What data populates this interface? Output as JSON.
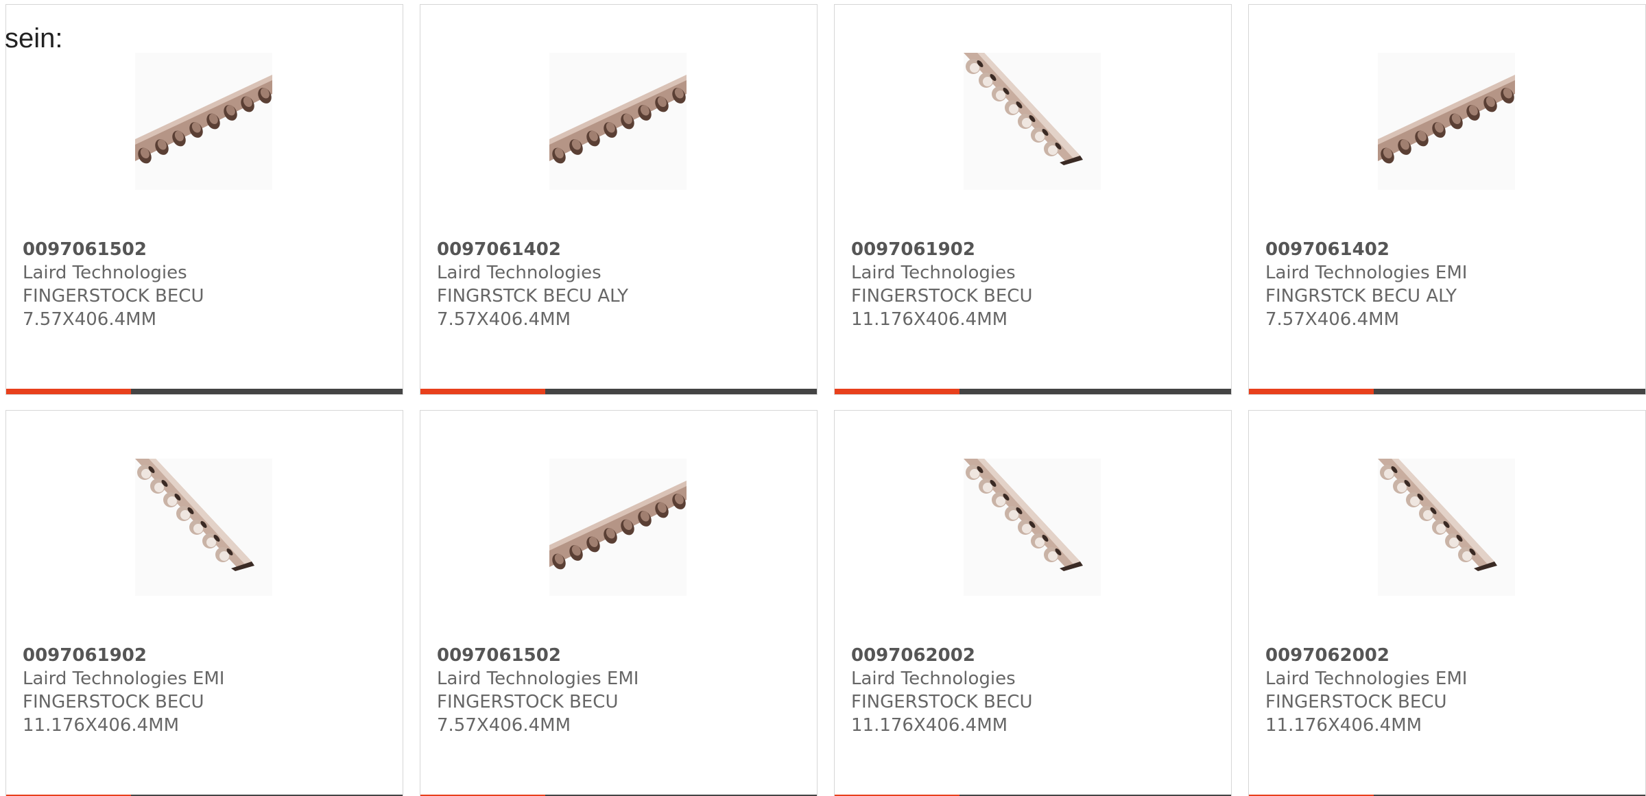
{
  "intro_text": "sein:",
  "colors": {
    "accent": "#e8401c",
    "bar": "#444444",
    "text": "#666666",
    "border": "#d6d6d6"
  },
  "products": [
    {
      "part_number": "0097061502",
      "manufacturer": "Laird Technologies",
      "line1": "FINGERSTOCK BECU",
      "line2": "7.57X406.4MM",
      "image_icon": "fingerstock-horizontal-icon"
    },
    {
      "part_number": "0097061402",
      "manufacturer": "Laird Technologies",
      "line1": "FINGRSTCK BECU ALY",
      "line2": "7.57X406.4MM",
      "image_icon": "fingerstock-horizontal-icon"
    },
    {
      "part_number": "0097061902",
      "manufacturer": "Laird Technologies",
      "line1": "FINGERSTOCK BECU",
      "line2": "11.176X406.4MM",
      "image_icon": "fingerstock-diagonal-icon"
    },
    {
      "part_number": "0097061402",
      "manufacturer": "Laird Technologies EMI",
      "line1": "FINGRSTCK BECU ALY",
      "line2": "7.57X406.4MM",
      "image_icon": "fingerstock-horizontal-icon"
    },
    {
      "part_number": "0097061902",
      "manufacturer": "Laird Technologies EMI",
      "line1": "FINGERSTOCK BECU",
      "line2": "11.176X406.4MM",
      "image_icon": "fingerstock-diagonal-icon"
    },
    {
      "part_number": "0097061502",
      "manufacturer": "Laird Technologies EMI",
      "line1": "FINGERSTOCK BECU",
      "line2": "7.57X406.4MM",
      "image_icon": "fingerstock-horizontal-icon"
    },
    {
      "part_number": "0097062002",
      "manufacturer": "Laird Technologies",
      "line1": "FINGERSTOCK BECU",
      "line2": "11.176X406.4MM",
      "image_icon": "fingerstock-diagonal-icon"
    },
    {
      "part_number": "0097062002",
      "manufacturer": "Laird Technologies EMI",
      "line1": "FINGERSTOCK BECU",
      "line2": "11.176X406.4MM",
      "image_icon": "fingerstock-diagonal-icon"
    }
  ]
}
